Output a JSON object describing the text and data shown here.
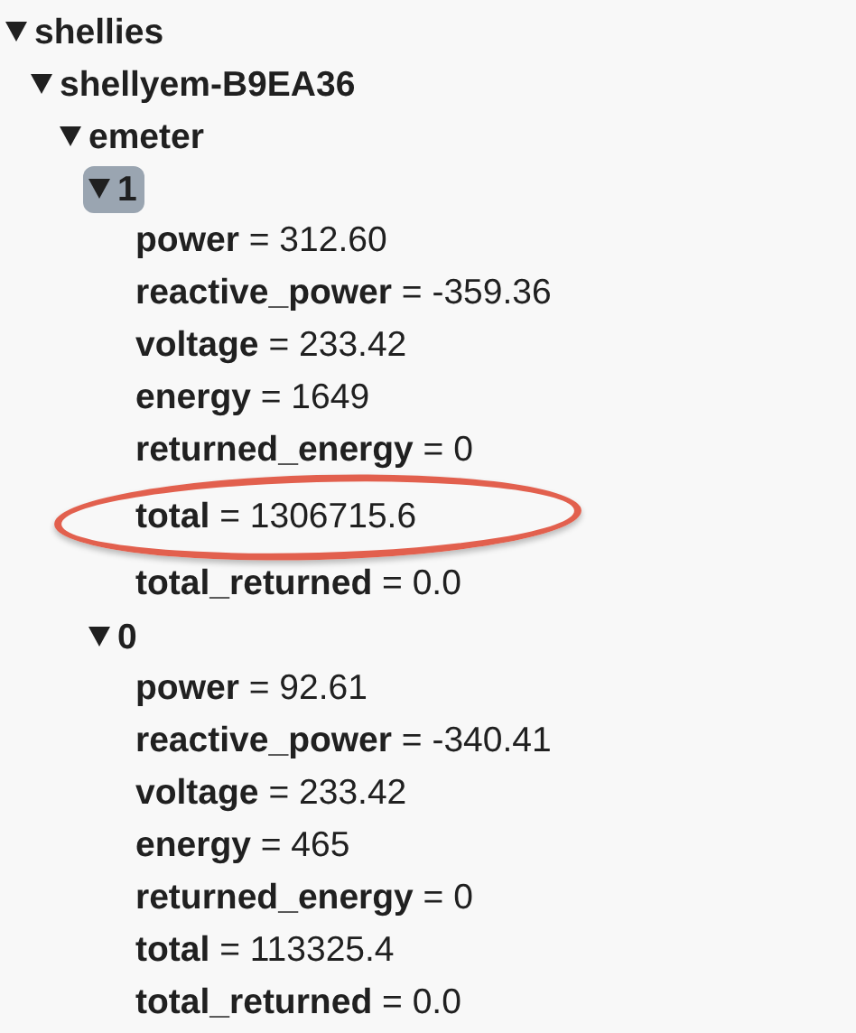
{
  "tree": [
    {
      "kind": "node",
      "label": "shellies",
      "expanded": true,
      "selected": false,
      "children": [
        {
          "kind": "node",
          "label": "shellyem-B9EA36",
          "expanded": true,
          "selected": false,
          "children": [
            {
              "kind": "node",
              "label": "emeter",
              "expanded": true,
              "selected": false,
              "children": [
                {
                  "kind": "node",
                  "label": "1",
                  "expanded": true,
                  "selected": true,
                  "children": [
                    {
                      "kind": "leaf",
                      "key": "power",
                      "separator": "=",
                      "value": "312.60",
                      "highlighted": false
                    },
                    {
                      "kind": "leaf",
                      "key": "reactive_power",
                      "separator": "=",
                      "value": "-359.36",
                      "highlighted": false
                    },
                    {
                      "kind": "leaf",
                      "key": "voltage",
                      "separator": "=",
                      "value": "233.42",
                      "highlighted": false
                    },
                    {
                      "kind": "leaf",
                      "key": "energy",
                      "separator": "=",
                      "value": "1649",
                      "highlighted": false
                    },
                    {
                      "kind": "leaf",
                      "key": "returned_energy",
                      "separator": "=",
                      "value": "0",
                      "highlighted": false
                    },
                    {
                      "kind": "leaf",
                      "key": "total",
                      "separator": "=",
                      "value": "1306715.6",
                      "highlighted": true
                    },
                    {
                      "kind": "leaf",
                      "key": "total_returned",
                      "separator": "=",
                      "value": "0.0",
                      "highlighted": false
                    }
                  ]
                },
                {
                  "kind": "node",
                  "label": "0",
                  "expanded": true,
                  "selected": false,
                  "children": [
                    {
                      "kind": "leaf",
                      "key": "power",
                      "separator": "=",
                      "value": "92.61",
                      "highlighted": false
                    },
                    {
                      "kind": "leaf",
                      "key": "reactive_power",
                      "separator": "=",
                      "value": "-340.41",
                      "highlighted": false
                    },
                    {
                      "kind": "leaf",
                      "key": "voltage",
                      "separator": "=",
                      "value": "233.42",
                      "highlighted": false
                    },
                    {
                      "kind": "leaf",
                      "key": "energy",
                      "separator": "=",
                      "value": "465",
                      "highlighted": false
                    },
                    {
                      "kind": "leaf",
                      "key": "returned_energy",
                      "separator": "=",
                      "value": "0",
                      "highlighted": false
                    },
                    {
                      "kind": "leaf",
                      "key": "total",
                      "separator": "=",
                      "value": "113325.4",
                      "highlighted": false
                    },
                    {
                      "kind": "leaf",
                      "key": "total_returned",
                      "separator": "=",
                      "value": "0.0",
                      "highlighted": false
                    }
                  ]
                }
              ]
            }
          ]
        }
      ]
    }
  ]
}
